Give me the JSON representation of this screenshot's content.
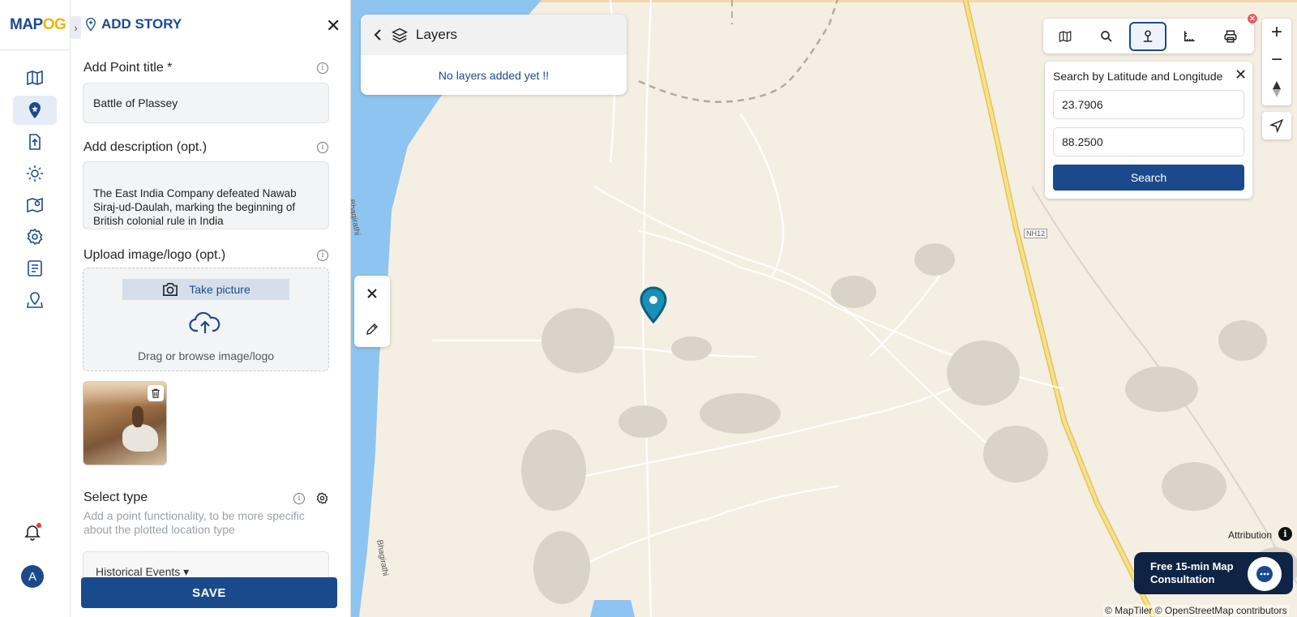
{
  "app": {
    "logo_main": "MAP",
    "logo_accent": "OG"
  },
  "rail": {
    "items": [
      "map-icon",
      "pin-icon",
      "upload-icon",
      "gear-cog-icon",
      "map-pin-icon",
      "settings-icon",
      "list-icon",
      "location-icon"
    ],
    "notification_icon": "bell-icon",
    "avatar_letter": "A"
  },
  "panel": {
    "title": "ADD STORY",
    "title_field_label": "Add Point title *",
    "title_value": "Battle of Plassey",
    "desc_label": "Add description (opt.)",
    "desc_value": "The East India Company defeated Nawab Siraj-ud-Daulah, marking the beginning of British colonial rule in India",
    "upload_label": "Upload image/logo (opt.)",
    "take_picture": "Take picture",
    "drag_text": "Drag or browse image/logo",
    "select_type_label": "Select type",
    "select_type_desc": "Add a point functionality, to be more specific about the plotted location type",
    "select_value": "Historical Events",
    "save_label": "SAVE"
  },
  "layers": {
    "title": "Layers",
    "empty_text": "No layers added yet !!"
  },
  "latlng": {
    "title": "Search by Latitude and Longitude",
    "latitude": "23.7906",
    "longitude": "88.2500",
    "search_label": "Search"
  },
  "map": {
    "river_label": "Bhagirathi",
    "road_badge": "NH12",
    "attribution": "Attribution",
    "consult_text": "Free 15-min Map Consultation",
    "copyright": "© MapTiler © OpenStreetMap contributors",
    "colors": {
      "water": "#8ec5f0",
      "land": "#f5efe3",
      "highway": "#f2d675",
      "brand": "#1b4a8c",
      "marker": "#1a8fb8"
    }
  }
}
